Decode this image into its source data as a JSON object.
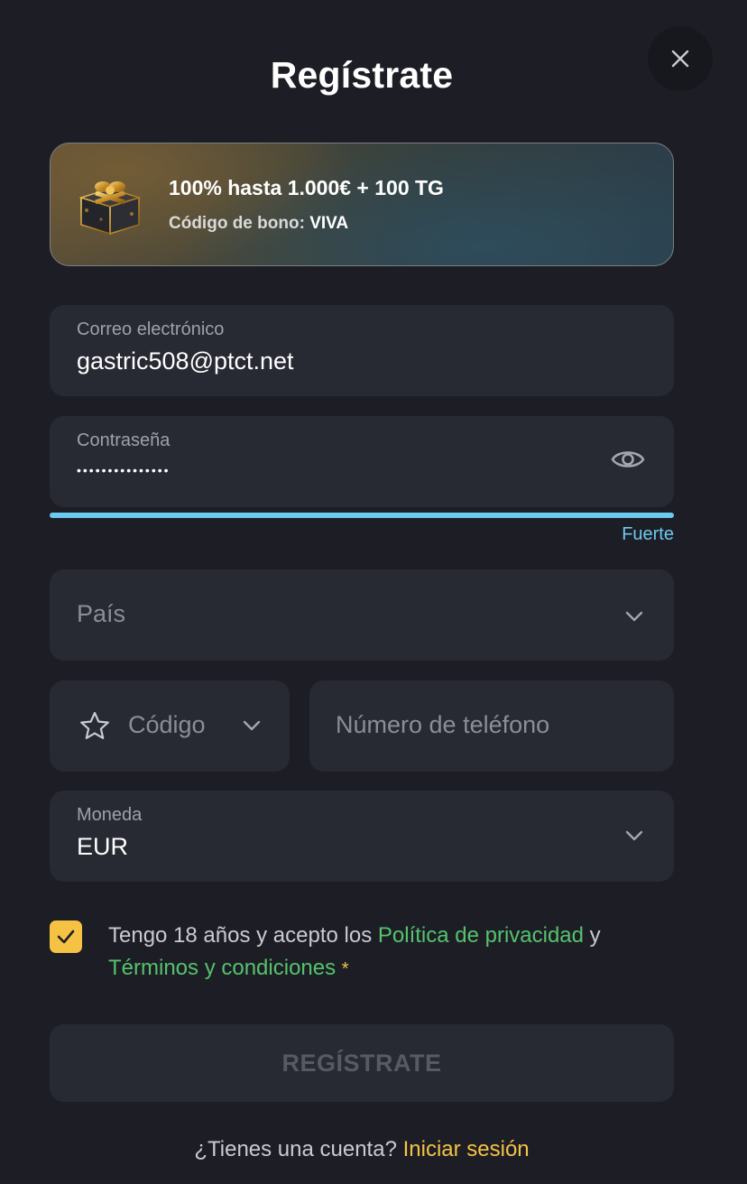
{
  "header": {
    "title": "Regístrate",
    "close_icon": "close-icon"
  },
  "bonus": {
    "title": "100% hasta 1.000€ + 100 TG",
    "code_label": "Código de bono:",
    "code_value": "VIVA",
    "icon": "gift-icon"
  },
  "form": {
    "email": {
      "label": "Correo electrónico",
      "value": "gastric508@ptct.net"
    },
    "password": {
      "label": "Contraseña",
      "value_masked": "•••••••••••••••",
      "toggle_icon": "eye-icon",
      "strength_label": "Fuerte",
      "strength_color": "#6cc9ef",
      "strength_fraction": 1.0
    },
    "country": {
      "placeholder": "País"
    },
    "phone_code": {
      "placeholder": "Código",
      "icon": "star-icon"
    },
    "phone_number": {
      "placeholder": "Número de teléfono"
    },
    "currency": {
      "label": "Moneda",
      "value": "EUR"
    },
    "terms": {
      "checked": true,
      "text_before": "Tengo 18 años y acepto los ",
      "privacy_link": "Política de privacidad",
      "text_between": " y ",
      "terms_link": "Términos y condiciones",
      "required_mark": "*"
    },
    "submit_label": "REGÍSTRATE"
  },
  "footer": {
    "question": "¿Tienes una cuenta?",
    "login_link": "Iniciar sesión"
  },
  "colors": {
    "background": "#1d1e25",
    "field": "#272933",
    "accent_yellow": "#f5c244",
    "link_green": "#55c26c",
    "strength_blue": "#6cc9ef"
  }
}
